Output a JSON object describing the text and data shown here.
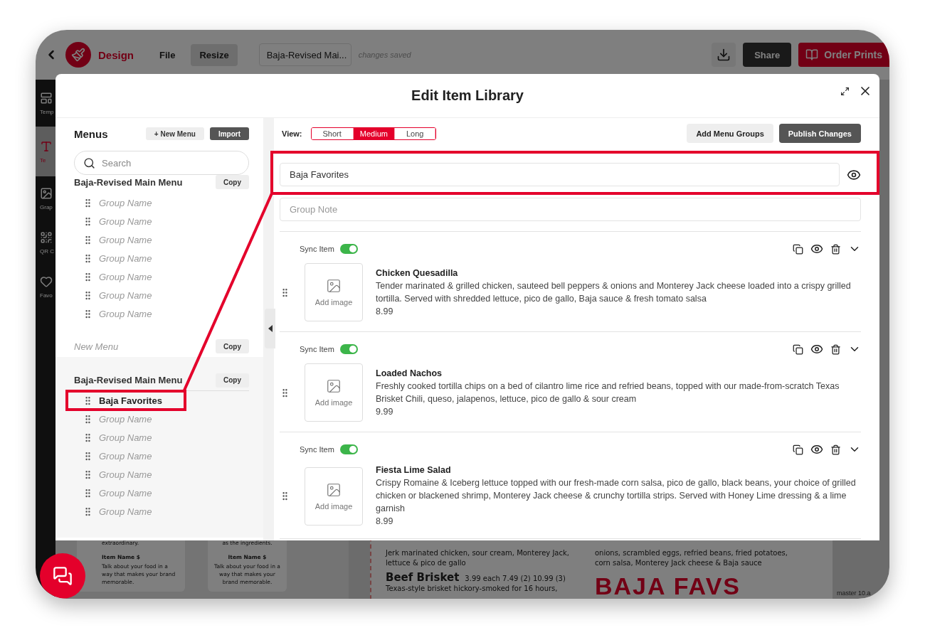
{
  "app_bar": {
    "brand": "Design",
    "menu": [
      {
        "label": "File",
        "selected": false
      },
      {
        "label": "Resize",
        "selected": true
      }
    ],
    "document_title": "Baja-Revised Mai...",
    "save_status": "changes saved",
    "share_button": "Share",
    "order_button": "Order Prints"
  },
  "tool_sidebar": [
    {
      "kind": "templates",
      "label": "Temp",
      "selected": false
    },
    {
      "kind": "text",
      "label": "Te",
      "selected": true
    },
    {
      "kind": "graphics",
      "label": "Grap",
      "selected": false
    },
    {
      "kind": "qr",
      "label": "QR C",
      "selected": false
    },
    {
      "kind": "favorites",
      "label": "Favo",
      "selected": false
    }
  ],
  "canvas": {
    "template_cards": [
      {
        "intro": "extraordinary.",
        "item_name": "Item Name $",
        "description": "Talk about your food in a way that makes your brand memorable."
      },
      {
        "intro": "as the ingredients.",
        "item_name": "Item Name $",
        "description": "Talk about your food in a way that makes your brand memorable."
      }
    ],
    "menu_page": {
      "left_column": [
        {
          "kind": "text",
          "text": "Jerk marinated chicken, sour cream, Monterey Jack,"
        },
        {
          "kind": "text",
          "text": "lettuce & pico de gallo"
        },
        {
          "kind": "heading",
          "name": "Beef Brisket",
          "prices": "3.99 each  7.49 (2)  10.99 (3)"
        },
        {
          "kind": "text",
          "text": "Texas-style brisket hickory-smoked for 16 hours,"
        }
      ],
      "right_column": [
        "onions, scrambled eggs, refried beans, fried potatoes,",
        "corn salsa, Monterey Jack cheese & Baja sauce"
      ],
      "banner": "BAJA FAVS"
    },
    "page_label": "master 10.a"
  },
  "modal": {
    "title": "Edit Item Library",
    "menus_panel": {
      "heading": "Menus",
      "new_menu_button": "+ New Menu",
      "import_button": "Import",
      "search_placeholder": "Search",
      "menus": [
        {
          "name": "Baja-Revised Main Menu",
          "untitled": false,
          "active": false,
          "copy_button": "Copy",
          "groups": [
            {
              "name": "Group Name",
              "untitled": true,
              "selected": false
            },
            {
              "name": "Group Name",
              "untitled": true,
              "selected": false
            },
            {
              "name": "Group Name",
              "untitled": true,
              "selected": false
            },
            {
              "name": "Group Name",
              "untitled": true,
              "selected": false
            },
            {
              "name": "Group Name",
              "untitled": true,
              "selected": false
            },
            {
              "name": "Group Name",
              "untitled": true,
              "selected": false
            },
            {
              "name": "Group Name",
              "untitled": true,
              "selected": false
            }
          ]
        },
        {
          "name": "New Menu",
          "untitled": true,
          "active": false,
          "copy_button": "Copy"
        },
        {
          "name": "Baja-Revised Main Menu",
          "untitled": false,
          "active": true,
          "copy_button": "Copy",
          "groups": [
            {
              "name": "Baja Favorites",
              "untitled": false,
              "selected": true
            },
            {
              "name": "Group Name",
              "untitled": true,
              "selected": false
            },
            {
              "name": "Group Name",
              "untitled": true,
              "selected": false
            },
            {
              "name": "Group Name",
              "untitled": true,
              "selected": false
            },
            {
              "name": "Group Name",
              "untitled": true,
              "selected": false
            },
            {
              "name": "Group Name",
              "untitled": true,
              "selected": false
            },
            {
              "name": "Group Name",
              "untitled": true,
              "selected": false
            }
          ]
        }
      ]
    },
    "editor": {
      "view_label": "View:",
      "views": [
        {
          "label": "Short",
          "selected": false
        },
        {
          "label": "Medium",
          "selected": true
        },
        {
          "label": "Long",
          "selected": false
        }
      ],
      "add_groups_button": "Add Menu Groups",
      "publish_button": "Publish Changes",
      "group_name": "Baja Favorites",
      "group_note_placeholder": "Group Note",
      "items": [
        {
          "sync_label": "Sync Item",
          "sync_on": true,
          "image_label": "Add image",
          "name": "Chicken Quesadilla",
          "description": "Tender marinated & grilled chicken, sauteed bell peppers & onions and Monterey Jack cheese loaded into a crispy grilled tortilla. Served with shredded lettuce, pico de gallo, Baja sauce & fresh tomato salsa",
          "price": "8.99"
        },
        {
          "sync_label": "Sync Item",
          "sync_on": true,
          "image_label": "Add image",
          "name": "Loaded Nachos",
          "description": "Freshly cooked tortilla chips on a bed of cilantro lime rice and refried beans, topped with our made-from-scratch Texas Brisket Chili, queso, jalapenos, lettuce, pico de gallo & sour cream",
          "price": "9.99"
        },
        {
          "sync_label": "Sync Item",
          "sync_on": true,
          "image_label": "Add image",
          "name": "Fiesta Lime Salad",
          "description": "Crispy Romaine & Iceberg lettuce topped with our fresh-made corn salsa, pico de gallo, black beans, your choice of grilled chicken or blackened shrimp, Monterey Jack cheese & crunchy tortilla strips. Served with Honey Lime dressing & a lime garnish",
          "price": "8.99"
        }
      ]
    }
  }
}
